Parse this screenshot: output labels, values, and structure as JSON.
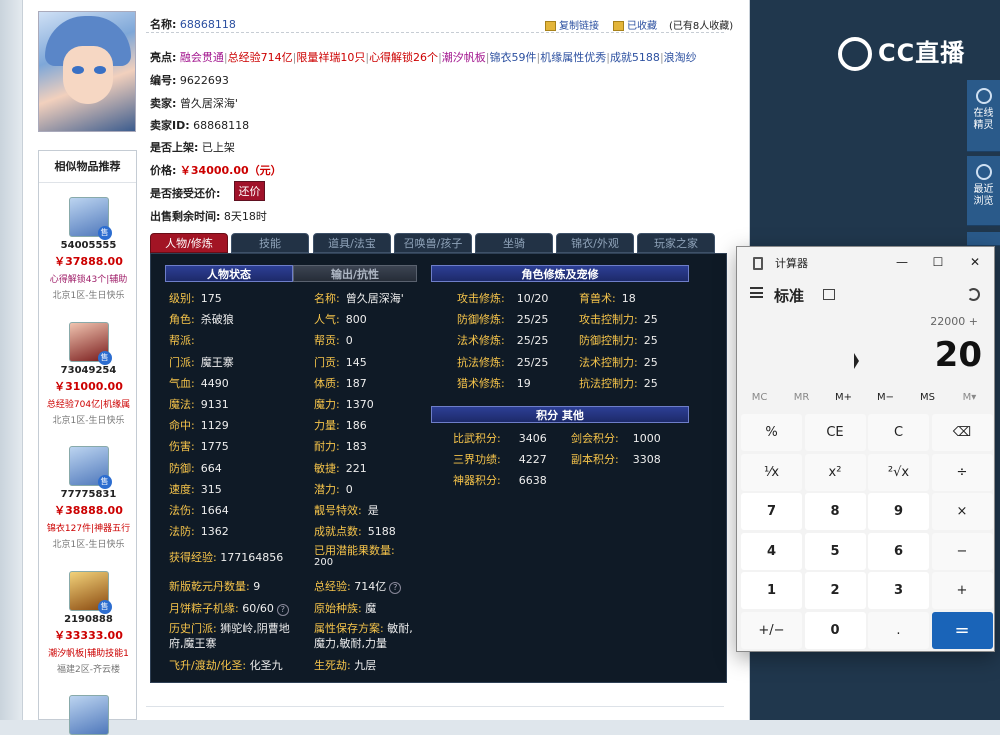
{
  "listing": {
    "name_label": "名称:",
    "name_value": "68868118",
    "copy_link": "复制链接",
    "favorited": "已收藏",
    "fav_count": "(已有8人收藏)",
    "highlights_label": "亮点:",
    "highlights": [
      "融会贯通",
      "总经验714亿",
      "限量祥瑞10只",
      "心得解锁26个",
      "潮汐帆板",
      "锦衣59件",
      "机缘属性优秀",
      "成就5188",
      "浪淘纱"
    ],
    "serial_label": "编号:",
    "serial_value": "9622693",
    "seller_label": "卖家:",
    "seller_value": "曾久居深海'",
    "seller_id_label": "卖家ID:",
    "seller_id_value": "68868118",
    "listed_label": "是否上架:",
    "listed_value": "已上架",
    "price_label": "价格:",
    "price_value": "￥34000.00（元）",
    "bargain_label": "是否接受还价:",
    "bargain_button": "还价",
    "time_label": "出售剩余时间:",
    "time_value": "8天18时"
  },
  "similar": {
    "title": "相似物品推荐",
    "items": [
      {
        "id": "54005555",
        "price": "￥37888.00",
        "tags": "心得解锁43个|辅助",
        "server": "北京1区-生日快乐",
        "badge": "售"
      },
      {
        "id": "73049254",
        "price": "￥31000.00",
        "tags": "总经验704亿|机缘属",
        "server": "北京1区-生日快乐",
        "badge": "售"
      },
      {
        "id": "77775831",
        "price": "￥38888.00",
        "tags": "锦衣127件|神器五行",
        "server": "北京1区-生日快乐",
        "badge": "售"
      },
      {
        "id": "2190888",
        "price": "￥33333.00",
        "tags": "潮汐帆板|辅助技能1",
        "server": "福建2区-齐云楼",
        "badge": "售"
      }
    ]
  },
  "tabs": [
    "人物/修炼",
    "技能",
    "道具/法宝",
    "召唤兽/孩子",
    "坐骑",
    "锦衣/外观",
    "玩家之家"
  ],
  "character": {
    "header_status": "人物状态",
    "header_output": "输出/抗性",
    "left_col": [
      [
        "级别:",
        "175"
      ],
      [
        "角色:",
        "杀破狼"
      ],
      [
        "帮派:",
        ""
      ],
      [
        "门派:",
        "魔王寨"
      ],
      [
        "气血:",
        "4490"
      ],
      [
        "魔法:",
        "9131"
      ],
      [
        "命中:",
        "1129"
      ],
      [
        "伤害:",
        "1775"
      ],
      [
        "防御:",
        "664"
      ],
      [
        "速度:",
        "315"
      ],
      [
        "法伤:",
        "1664"
      ],
      [
        "法防:",
        "1362"
      ]
    ],
    "mid_col": [
      [
        "名称:",
        "曾久居深海'"
      ],
      [
        "人气:",
        "800"
      ],
      [
        "帮贡:",
        "0"
      ],
      [
        "门贡:",
        "145"
      ],
      [
        "体质:",
        "187"
      ],
      [
        "魔力:",
        "1370"
      ],
      [
        "力量:",
        "186"
      ],
      [
        "耐力:",
        "183"
      ],
      [
        "敏捷:",
        "221"
      ],
      [
        "潜力:",
        "0"
      ],
      [
        "靓号特效:",
        "是"
      ],
      [
        "成就点数:",
        "5188"
      ]
    ],
    "exp_label": "获得经验:",
    "exp_value": "177164856",
    "used_potential_label": "已用潜能果数量:",
    "used_potential_value": "200",
    "qiankun_label": "新版乾元丹数量:",
    "qiankun_value": "9",
    "total_exp_label": "总经验:",
    "total_exp_value": "714亿",
    "moon_label": "月饼粽子机缘:",
    "moon_value": "60/60",
    "race_label": "原始种族:",
    "race_value": "魔",
    "history_label": "历史门派:",
    "history_value": "狮驼岭,阴曹地府,魔王寨",
    "attr_label": "属性保存方案:",
    "attr_value": "敏耐,魔力,敏耐,力量",
    "ascend_label": "飞升/渡劫/化圣:",
    "ascend_value": "化圣九",
    "life_label": "生死劫:",
    "life_value": "九层"
  },
  "cultivation": {
    "header": "角色修炼及宠修",
    "rows": [
      [
        "攻击修炼:",
        "10/20",
        "育兽术:",
        "18"
      ],
      [
        "防御修炼:",
        "25/25",
        "攻击控制力:",
        "25"
      ],
      [
        "法术修炼:",
        "25/25",
        "防御控制力:",
        "25"
      ],
      [
        "抗法修炼:",
        "25/25",
        "法术控制力:",
        "25"
      ],
      [
        "猎术修炼:",
        "19",
        "抗法控制力:",
        "25"
      ]
    ]
  },
  "scores": {
    "header": "积分  其他",
    "rows": [
      [
        "比武积分:",
        "3406",
        "剑会积分:",
        "1000"
      ],
      [
        "三界功绩:",
        "4227",
        "副本积分:",
        "3308"
      ],
      [
        "神器积分:",
        "6638",
        "",
        ""
      ]
    ]
  },
  "overlay": {
    "logo_text": "CC直播",
    "tool1": "在线精灵",
    "tool2": "最近浏览"
  },
  "calculator": {
    "title": "计算器",
    "mode": "标准",
    "expression": "22000 +",
    "display": "20",
    "memory": [
      "MC",
      "MR",
      "M+",
      "M−",
      "MS",
      "M▾"
    ],
    "keys": [
      [
        "%",
        "CE",
        "C",
        "⌫"
      ],
      [
        "¹⁄x",
        "x²",
        "²√x",
        "÷"
      ],
      [
        "7",
        "8",
        "9",
        "×"
      ],
      [
        "4",
        "5",
        "6",
        "−"
      ],
      [
        "1",
        "2",
        "3",
        "+"
      ],
      [
        "+/−",
        "0",
        ".",
        "="
      ]
    ],
    "win_min": "—",
    "win_max": "☐",
    "win_close": "✕"
  }
}
